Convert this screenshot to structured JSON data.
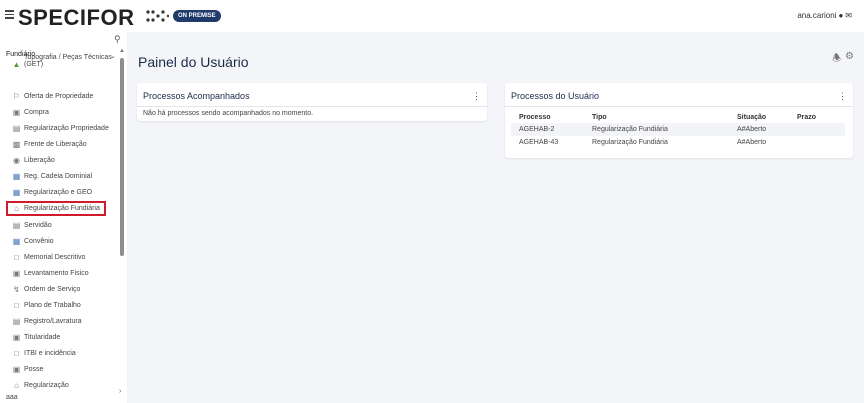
{
  "header": {
    "brand": "SPECIFOR",
    "badge": "ON PREMISE",
    "user": "ana.carioni"
  },
  "sidebar": {
    "group": "Fundiário",
    "items": [
      {
        "label": "Topografia / Peças Técnicas",
        "label2": "(GET)",
        "icon": "map-icon"
      },
      {
        "label": "Oferta de Propriedade",
        "icon": "sign-icon"
      },
      {
        "label": "Compra",
        "icon": "cart-icon"
      },
      {
        "label": "Regularização Propriedade",
        "icon": "document-icon"
      },
      {
        "label": "Frente de Liberação",
        "icon": "truck-icon"
      },
      {
        "label": "Liberação",
        "icon": "tractor-icon"
      },
      {
        "label": "Reg. Cadeia Dominial",
        "icon": "broken-image-icon"
      },
      {
        "label": "Regularização e GEO",
        "icon": "broken-image-icon"
      },
      {
        "label": "Regularização Fundiária",
        "icon": "house-icon"
      },
      {
        "label": "Servidão",
        "icon": "document-icon"
      },
      {
        "label": "Convênio",
        "icon": "broken-image-icon"
      },
      {
        "label": "Memorial Descritivo",
        "icon": "file-icon"
      },
      {
        "label": "Levantamento Fisico",
        "icon": "building-icon"
      },
      {
        "label": "Ordem de Serviço",
        "icon": "bolt-icon"
      },
      {
        "label": "Plano de Trabalho",
        "icon": "file-icon"
      },
      {
        "label": "Registro/Lavratura",
        "icon": "ledger-icon"
      },
      {
        "label": "Titularidade",
        "icon": "building-icon"
      },
      {
        "label": "ITBI e incidência",
        "icon": "file-icon"
      },
      {
        "label": "Posse",
        "icon": "building-icon"
      },
      {
        "label": "Regularização",
        "icon": "house-icon"
      }
    ],
    "more_label": "aaa"
  },
  "main": {
    "title": "Painel do Usuário",
    "followed": {
      "title": "Processos Acompanhados",
      "empty": "Não há processos sendo acompanhados no momento."
    },
    "user_processes": {
      "title": "Processos do Usuário",
      "columns": [
        "Processo",
        "Tipo",
        "Situação",
        "Prazo"
      ],
      "rows": [
        [
          "AGEHAB-2",
          "Regularização Fundiária",
          "A#Aberto",
          ""
        ],
        [
          "AGEHAB-43",
          "Regularização Fundiária",
          "A#Aberto",
          ""
        ]
      ]
    }
  },
  "colors": {
    "brand_badge": "#1f3a6b",
    "active_outline": "#d11a2a",
    "title": "#1e2a4a"
  }
}
